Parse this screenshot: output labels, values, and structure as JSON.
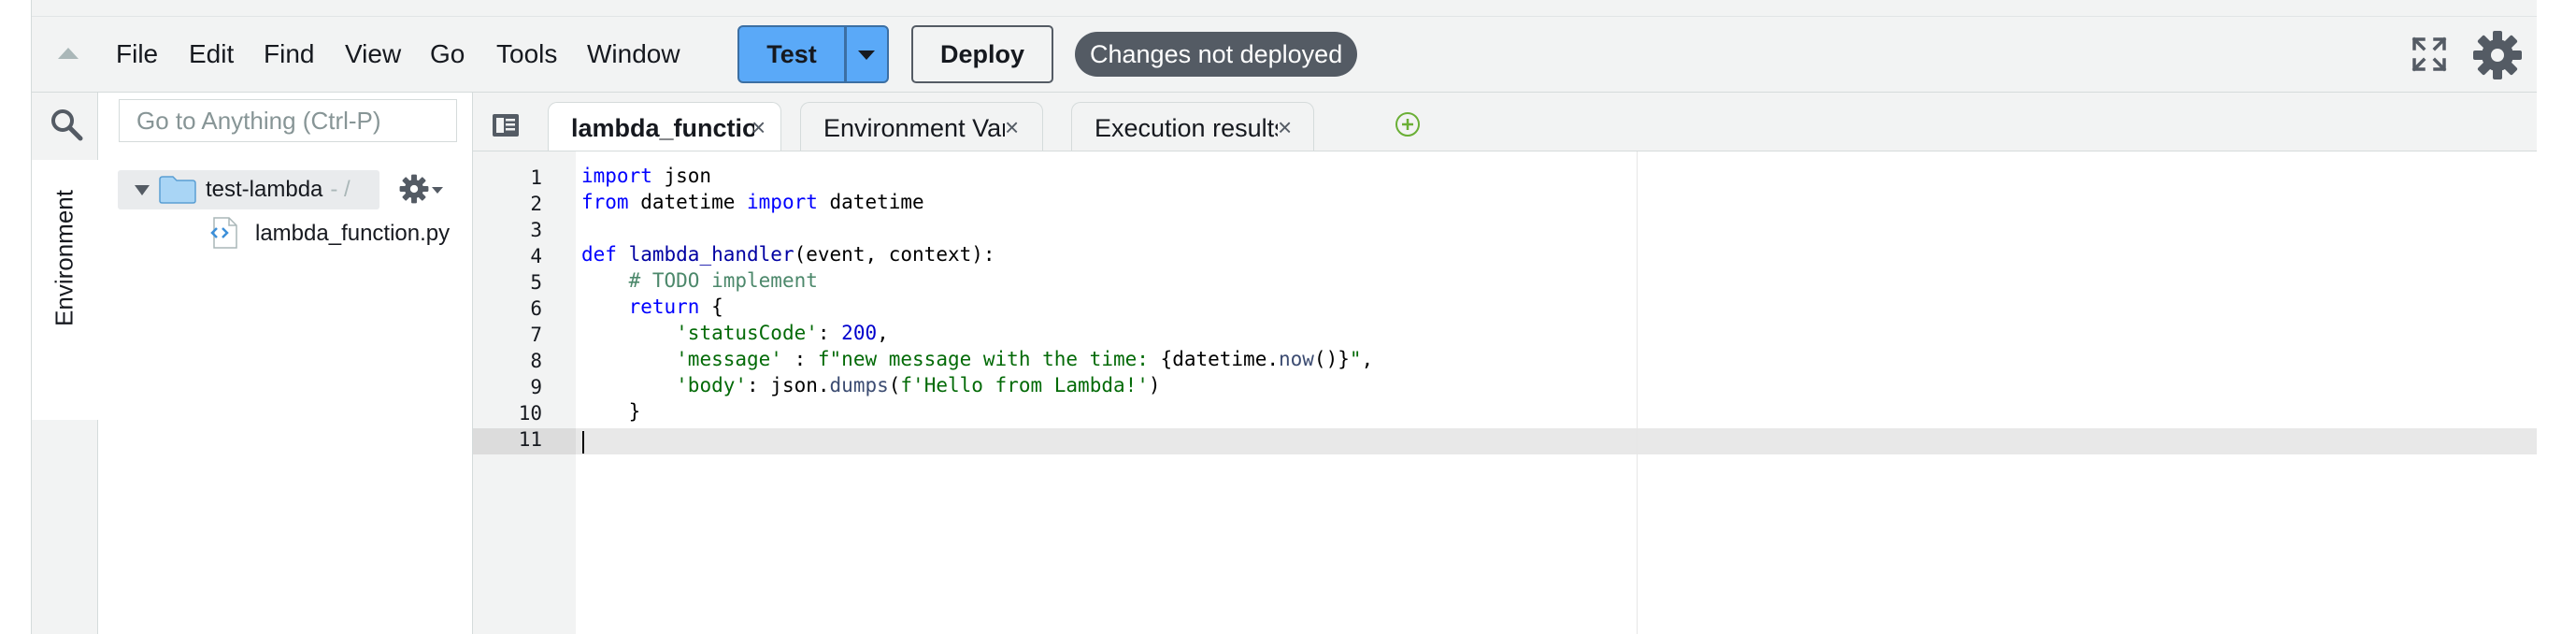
{
  "menubar": {
    "items": [
      "File",
      "Edit",
      "Find",
      "View",
      "Go",
      "Tools",
      "Window"
    ],
    "test_label": "Test",
    "deploy_label": "Deploy",
    "status_badge": "Changes not deployed"
  },
  "left_rail": {
    "tab_label": "Environment"
  },
  "file_panel": {
    "goto_placeholder": "Go to Anything (Ctrl-P)",
    "root_folder": "test-lambda",
    "root_suffix": "- /",
    "file": "lambda_function.py"
  },
  "editor": {
    "tabs": [
      {
        "label": "lambda_function",
        "active": true
      },
      {
        "label": "Environment Vari",
        "active": false
      },
      {
        "label": "Execution results",
        "active": false
      }
    ],
    "close_glyph": "×",
    "line_numbers": [
      "1",
      "2",
      "3",
      "4",
      "5",
      "6",
      "7",
      "8",
      "9",
      "10",
      "11"
    ],
    "code": [
      [
        {
          "t": "import",
          "c": "kw"
        },
        {
          "t": " json",
          "c": ""
        }
      ],
      [
        {
          "t": "from",
          "c": "kw"
        },
        {
          "t": " datetime ",
          "c": ""
        },
        {
          "t": "import",
          "c": "kw"
        },
        {
          "t": " datetime",
          "c": ""
        }
      ],
      [],
      [
        {
          "t": "def",
          "c": "kw"
        },
        {
          "t": " ",
          "c": ""
        },
        {
          "t": "lambda_handler",
          "c": "fn"
        },
        {
          "t": "(event, context):",
          "c": ""
        }
      ],
      [
        {
          "t": "    ",
          "c": ""
        },
        {
          "t": "# TODO implement",
          "c": "cm"
        }
      ],
      [
        {
          "t": "    ",
          "c": ""
        },
        {
          "t": "return",
          "c": "kw"
        },
        {
          "t": " {",
          "c": ""
        }
      ],
      [
        {
          "t": "        ",
          "c": ""
        },
        {
          "t": "'statusCode'",
          "c": "str"
        },
        {
          "t": ": ",
          "c": ""
        },
        {
          "t": "200",
          "c": "num"
        },
        {
          "t": ",",
          "c": ""
        }
      ],
      [
        {
          "t": "        ",
          "c": ""
        },
        {
          "t": "'message'",
          "c": "str"
        },
        {
          "t": " : ",
          "c": ""
        },
        {
          "t": "f\"new message with the time: ",
          "c": "str"
        },
        {
          "t": "{datetime.",
          "c": ""
        },
        {
          "t": "now",
          "c": "meth"
        },
        {
          "t": "()}",
          "c": ""
        },
        {
          "t": "\"",
          "c": "str"
        },
        {
          "t": ",",
          "c": ""
        }
      ],
      [
        {
          "t": "        ",
          "c": ""
        },
        {
          "t": "'body'",
          "c": "str"
        },
        {
          "t": ": json.",
          "c": ""
        },
        {
          "t": "dumps",
          "c": "meth"
        },
        {
          "t": "(",
          "c": ""
        },
        {
          "t": "f'Hello from Lambda!'",
          "c": "str"
        },
        {
          "t": ")",
          "c": ""
        }
      ],
      [
        {
          "t": "    }",
          "c": ""
        }
      ],
      []
    ]
  },
  "colors": {
    "test_button": "#5aa9f8",
    "badge_bg": "#545b64",
    "chrome_bg": "#f2f3f3",
    "keyword": "#0000ff",
    "string": "#036a07",
    "comment": "#4c886b"
  },
  "icons": [
    "collapse-arrow-icon",
    "chevron-down-icon",
    "fullscreen-icon",
    "gear-icon",
    "search-icon",
    "folder-icon",
    "python-file-icon",
    "tab-menu-icon",
    "close-icon",
    "add-tab-icon"
  ]
}
